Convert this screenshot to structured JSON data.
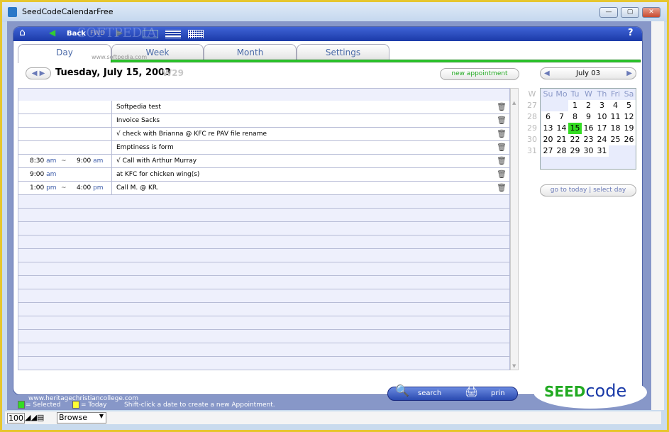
{
  "window": {
    "title": "SeedCodeCalendarFree"
  },
  "toolbar": {
    "back": "Back",
    "fwd": "FWD",
    "help": "?"
  },
  "watermark": {
    "text": "SOFTPEDIA",
    "url": "www.softpedia.com",
    "site": "www.heritagechristiancollege.com"
  },
  "tabs": [
    {
      "label": "Day"
    },
    {
      "label": "Week"
    },
    {
      "label": "Month"
    },
    {
      "label": "Settings"
    }
  ],
  "day": {
    "date": "Tuesday, July 15, 2003",
    "week": "W29",
    "new_appointment": "new appointment"
  },
  "appointments": [
    {
      "start": "",
      "start_ampm": "",
      "sep": "",
      "end": "",
      "end_ampm": "",
      "title": "Softpedia test"
    },
    {
      "start": "",
      "start_ampm": "",
      "sep": "",
      "end": "",
      "end_ampm": "",
      "title": "Invoice Sacks"
    },
    {
      "start": "",
      "start_ampm": "",
      "sep": "",
      "end": "",
      "end_ampm": "",
      "title": "√ check with Brianna @ KFC re PAV file rename"
    },
    {
      "start": "",
      "start_ampm": "",
      "sep": "",
      "end": "",
      "end_ampm": "",
      "title": "Emptiness is form"
    },
    {
      "start": "8:30",
      "start_ampm": "am",
      "sep": "~",
      "end": "9:00",
      "end_ampm": "am",
      "title": "√ Call with Arthur Murray"
    },
    {
      "start": "9:00",
      "start_ampm": "am",
      "sep": "",
      "end": "",
      "end_ampm": "",
      "title": "at KFC for chicken wing(s)"
    },
    {
      "start": "1:00",
      "start_ampm": "pm",
      "sep": "~",
      "end": "4:00",
      "end_ampm": "pm",
      "title": "Call M. @ KR."
    }
  ],
  "minical": {
    "month": "July 03",
    "week_header": "W",
    "days": [
      "Su",
      "Mo",
      "Tu",
      "W",
      "Th",
      "Fri",
      "Sa"
    ],
    "weeks": [
      [
        "27",
        [
          "",
          "",
          "1",
          "2",
          "3",
          "4",
          "5"
        ]
      ],
      [
        "28",
        [
          "6",
          "7",
          "8",
          "9",
          "10",
          "11",
          "12"
        ]
      ],
      [
        "29",
        [
          "13",
          "14",
          "15",
          "16",
          "17",
          "18",
          "19"
        ]
      ],
      [
        "30",
        [
          "20",
          "21",
          "22",
          "23",
          "24",
          "25",
          "26"
        ]
      ],
      [
        "31",
        [
          "27",
          "28",
          "29",
          "30",
          "31",
          "",
          ""
        ]
      ]
    ],
    "selected": "15",
    "go_to_today": "go to today",
    "select_day": "select day"
  },
  "footer": {
    "search": "search",
    "print": "prin",
    "logo_a": "SEED",
    "logo_b": "code",
    "legend_selected": "= Selected",
    "legend_today": "= Today",
    "hint": "Shift-click a date to create a new Appointment.",
    "selected_color": "#33dd22",
    "today_color": "#ffff33"
  },
  "statusbar": {
    "zoom": "100",
    "mode": "Browse"
  }
}
